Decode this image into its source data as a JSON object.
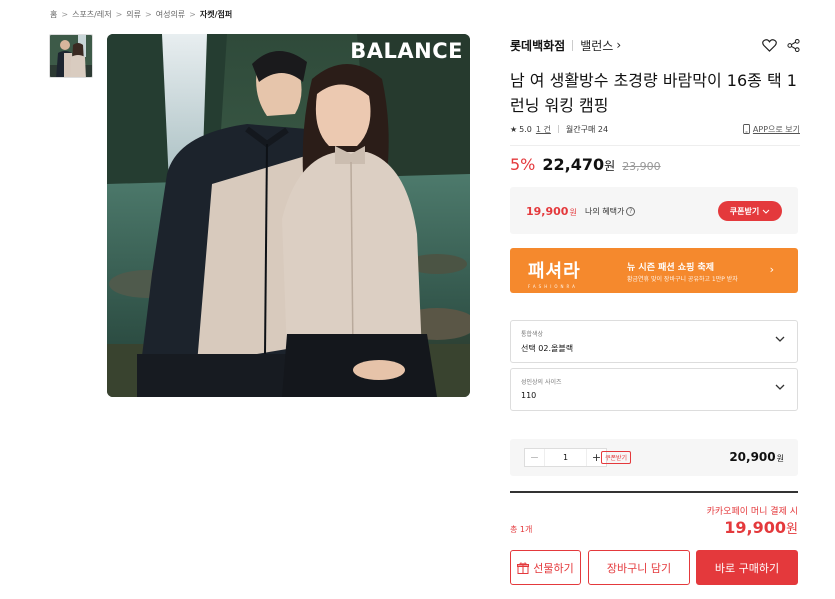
{
  "breadcrumb": {
    "items": [
      "홈",
      "스포츠/레저",
      "의류",
      "여성의류"
    ],
    "current": "자켓/점퍼",
    "separator": ">"
  },
  "image": {
    "brand_overlay": "BALANCE"
  },
  "seller": {
    "name": "롯데백화점",
    "brand": "밸런스",
    "brand_chevron": "›",
    "icons": [
      "heart-icon",
      "share-icon"
    ]
  },
  "product": {
    "title": "남 여 생활방수 초경량 바람막이 16종 택 1 런닝 워킹 캠핑",
    "rating": "5.0",
    "reviews": "1 건",
    "monthly": "월간구매 24",
    "app_link": "APP으로 보기",
    "star": "★"
  },
  "price": {
    "discount": "5%",
    "current": "22,470",
    "current_unit": "원",
    "original": "23,900"
  },
  "benefit": {
    "price": "19,900",
    "unit": "원",
    "label": "나의 혜택가",
    "info": "?",
    "coupon_btn": "쿠폰받기"
  },
  "banner": {
    "logo": "패셔라",
    "logo_sub": "FASHIONRA",
    "title": "뉴 시즌 패션 쇼핑 축제",
    "subtitle": "황금연휴 맞이 장바구니 공유하고 1만P 받자",
    "chevron": "›"
  },
  "options": [
    {
      "label": "통합색상",
      "value": "선택 02.올블랙"
    },
    {
      "label": "성인상의 사이즈",
      "value": "110"
    }
  ],
  "quantity": {
    "minus": "−",
    "value": "1",
    "plus": "+",
    "coupon": "쿠폰받기",
    "price": "20,900",
    "unit": "원"
  },
  "total": {
    "kakao_text": "카카오페이 머니 결제 시",
    "count_label": "총 1개",
    "price": "19,900",
    "unit": "원"
  },
  "buttons": {
    "gift": "선물하기",
    "cart": "장바구니 담기",
    "buy": "바로 구매하기"
  },
  "colors": {
    "accent": "#e4393c",
    "banner": "#f5892d"
  }
}
